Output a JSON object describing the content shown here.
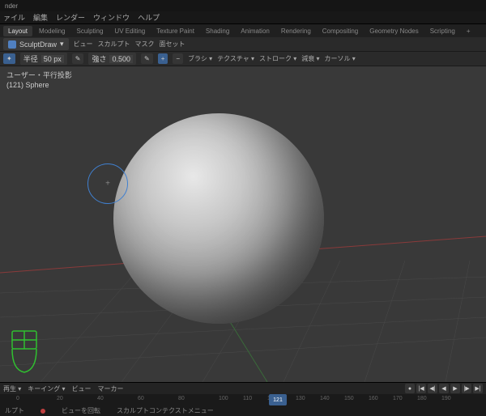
{
  "app": {
    "title": "nder"
  },
  "menus": [
    "ァイル",
    "編集",
    "レンダー",
    "ウィンドウ",
    "ヘルプ"
  ],
  "workspaces": {
    "active": "Layout",
    "tabs": [
      "Layout",
      "Modeling",
      "Sculpting",
      "UV Editing",
      "Texture Paint",
      "Shading",
      "Animation",
      "Rendering",
      "Compositing",
      "Geometry Nodes",
      "Scripting"
    ]
  },
  "mode": {
    "label": "SculptDraw"
  },
  "viewmenu": [
    "ビュー",
    "スカルプト",
    "マスク",
    "面セット"
  ],
  "brush": {
    "radius_label": "半径",
    "radius_value": "50 px",
    "strength_label": "強さ",
    "strength_value": "0.500",
    "dd_brush": "ブラシ ▾",
    "dd_texture": "テクスチャ ▾",
    "dd_stroke": "ストローク ▾",
    "dd_falloff": "減衰 ▾",
    "dd_cursor": "カーソル ▾"
  },
  "overlay": {
    "line1": "ユーザー・平行投影",
    "line2": "(121) Sphere"
  },
  "timeline": {
    "menus": [
      "再生 ▾",
      "キーイング ▾",
      "ビュー",
      "マーカー"
    ],
    "current": "121",
    "ticks": [
      0,
      20,
      40,
      60,
      80,
      100,
      110,
      120,
      130,
      140,
      150,
      160,
      170,
      180,
      190
    ]
  },
  "status": {
    "left": "ルプト",
    "mid": "ビューを回転",
    "right": "スカルプトコンテクストメニュー"
  }
}
